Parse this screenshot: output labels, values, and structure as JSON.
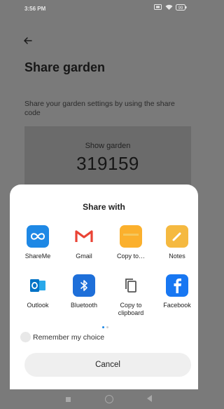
{
  "status_bar": {
    "time": "3:56 PM",
    "battery": "99"
  },
  "screen": {
    "title": "Share garden",
    "description": "Share your garden settings by using the share code",
    "code_label": "Show garden",
    "code_value": "319159"
  },
  "share_sheet": {
    "title": "Share with",
    "apps": [
      {
        "label": "ShareMe",
        "icon": "shareme-icon",
        "color": "#1e88e5"
      },
      {
        "label": "Gmail",
        "icon": "gmail-icon",
        "color": "#ea4335"
      },
      {
        "label": "Copy to…",
        "icon": "folder-icon",
        "color": "#fbb02d"
      },
      {
        "label": "Notes",
        "icon": "notes-icon",
        "color": "#f5b940"
      },
      {
        "label": "Outlook",
        "icon": "outlook-icon",
        "color": "#0072c6"
      },
      {
        "label": "Bluetooth",
        "icon": "bluetooth-icon",
        "color": "#1e6fd9"
      },
      {
        "label": "Copy to clipboard",
        "icon": "clipboard-icon",
        "color": "#555555"
      },
      {
        "label": "Facebook",
        "icon": "facebook-icon",
        "color": "#1877f2"
      }
    ],
    "remember_label": "Remember my choice",
    "cancel_label": "Cancel"
  }
}
